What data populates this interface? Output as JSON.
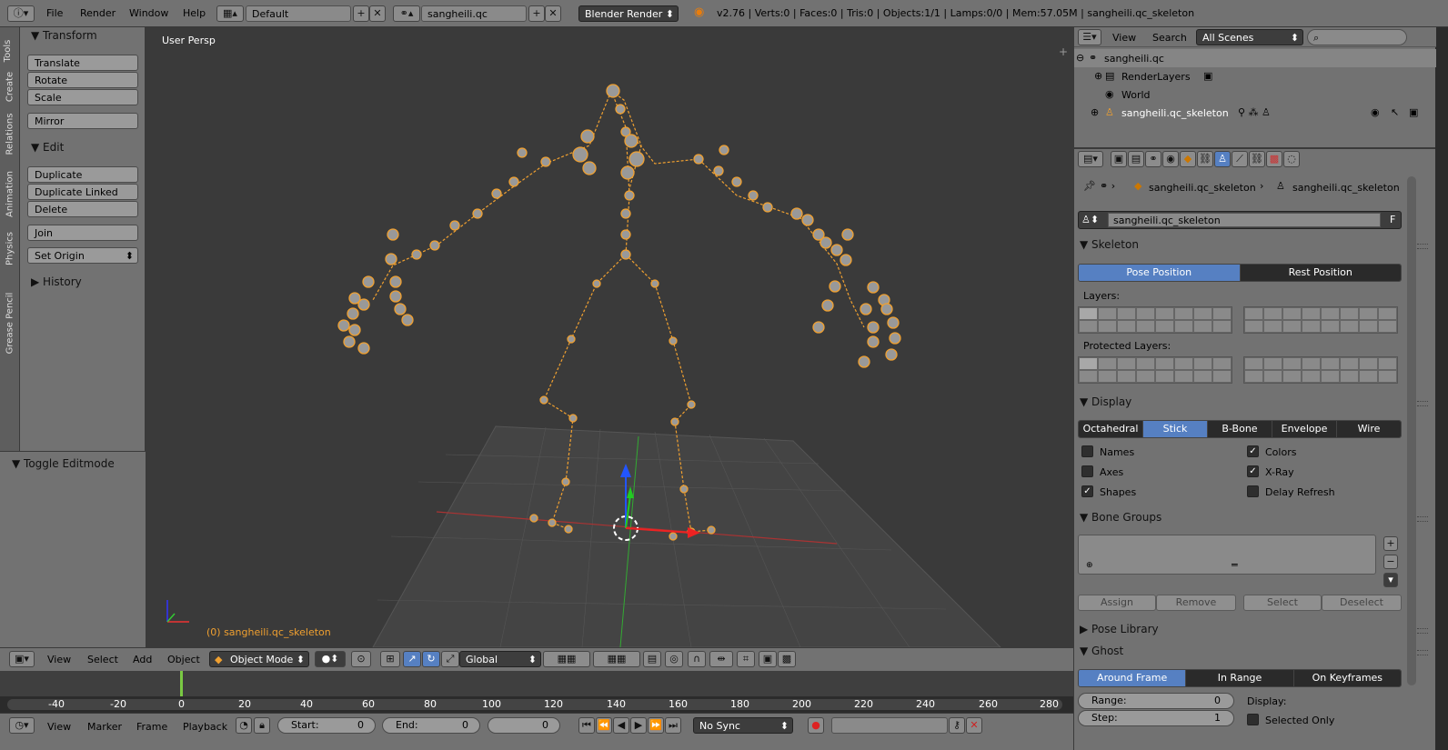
{
  "topbar": {
    "menus": [
      "File",
      "Render",
      "Window",
      "Help"
    ],
    "layout": "Default",
    "scene": "sangheili.qc",
    "engine": "Blender Render",
    "stats": "v2.76 | Verts:0 | Faces:0 | Tris:0 | Objects:1/1 | Lamps:0/0 | Mem:57.05M | sangheili.qc_skeleton"
  },
  "toolshelf": {
    "tabs": [
      "Tools",
      "Create",
      "Relations",
      "Animation",
      "Physics",
      "Grease Pencil"
    ],
    "transform_title": "Transform",
    "transform_buttons": [
      "Translate",
      "Rotate",
      "Scale",
      "Mirror"
    ],
    "edit_title": "Edit",
    "edit_buttons": [
      "Duplicate",
      "Duplicate Linked",
      "Delete",
      "Join",
      "Set Origin"
    ],
    "history_title": "History",
    "toggle_editmode": "Toggle Editmode"
  },
  "viewport": {
    "view_label": "User Persp",
    "object_label": "(0) sangheili.qc_skeleton"
  },
  "view3d_header": {
    "menus": [
      "View",
      "Select",
      "Add",
      "Object"
    ],
    "mode": "Object Mode",
    "orientation": "Global"
  },
  "timeline": {
    "ticks": [
      "-40",
      "-20",
      "0",
      "20",
      "40",
      "60",
      "80",
      "100",
      "120",
      "140",
      "160",
      "180",
      "200",
      "220",
      "240",
      "260",
      "280"
    ],
    "menus": [
      "View",
      "Marker",
      "Frame",
      "Playback"
    ],
    "start_label": "Start:",
    "start_value": "0",
    "end_label": "End:",
    "end_value": "0",
    "current_frame": "0",
    "sync": "No Sync"
  },
  "outliner": {
    "menus": [
      "View",
      "Search"
    ],
    "filter": "All Scenes",
    "items": [
      "sangheili.qc",
      "RenderLayers",
      "World",
      "sangheili.qc_skeleton"
    ]
  },
  "properties": {
    "breadcrumb_object": "sangheili.qc_skeleton",
    "breadcrumb_data": "sangheili.qc_skeleton",
    "datablock_name": "sangheili.qc_skeleton",
    "datablock_fake": "F",
    "skeleton_title": "Skeleton",
    "pose_position": "Pose Position",
    "rest_position": "Rest Position",
    "layers_label": "Layers:",
    "protected_layers_label": "Protected Layers:",
    "display_title": "Display",
    "display_types": [
      "Octahedral",
      "Stick",
      "B-Bone",
      "Envelope",
      "Wire"
    ],
    "display_active": "Stick",
    "options": {
      "names": "Names",
      "axes": "Axes",
      "shapes": "Shapes",
      "colors": "Colors",
      "xray": "X-Ray",
      "delay_refresh": "Delay Refresh"
    },
    "bone_groups_title": "Bone Groups",
    "bone_group_buttons": [
      "Assign",
      "Remove",
      "Select",
      "Deselect"
    ],
    "pose_library_title": "Pose Library",
    "ghost_title": "Ghost",
    "ghost_types": [
      "Around Frame",
      "In Range",
      "On Keyframes"
    ],
    "range_label": "Range:",
    "range_value": "0",
    "step_label": "Step:",
    "step_value": "1",
    "display_label": "Display:",
    "selected_only": "Selected Only"
  },
  "colors": {
    "accent": "#5680c2",
    "bone": "#f0a030",
    "playhead": "#7ac943"
  }
}
